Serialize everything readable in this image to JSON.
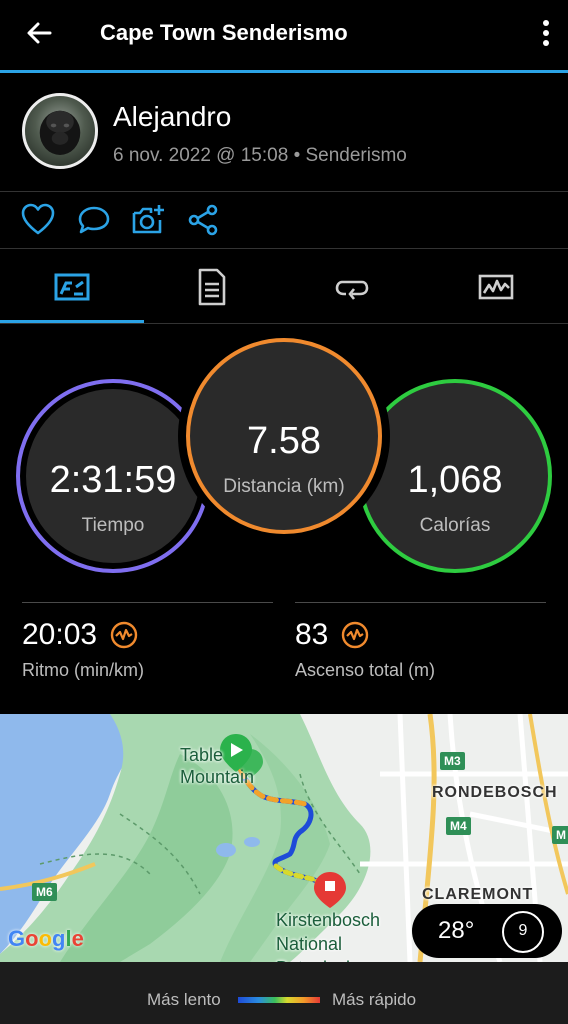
{
  "appbar": {
    "title": "Cape Town Senderismo"
  },
  "header": {
    "name": "Alejandro",
    "meta": "6 nov. 2022 @ 15:08 • Senderismo"
  },
  "actions": [
    "heart-icon",
    "comment-icon",
    "add-photo-icon",
    "share-icon"
  ],
  "tabs": [
    "stats-tab-icon",
    "details-tab-icon",
    "laps-tab-icon",
    "charts-tab-icon"
  ],
  "stats": {
    "time": {
      "value": "2:31:59",
      "label": "Tiempo",
      "color": "#7f6ef0"
    },
    "distance": {
      "value": "7.58",
      "label": "Distancia (km)",
      "color": "#f08a2e"
    },
    "calories": {
      "value": "1,068",
      "label": "Calorías",
      "color": "#2ecc40"
    }
  },
  "metrics": {
    "pace": {
      "value": "20:03",
      "label": "Ritmo (min/km)",
      "icon": "performance-icon"
    },
    "ascent": {
      "value": "83",
      "label": "Ascenso total (m)",
      "icon": "performance-icon"
    }
  },
  "map": {
    "labels": {
      "table_mountain": "Table\nMountain",
      "rondebosch": "RONDEBOSCH",
      "claremont": "CLAREMONT",
      "kirstenbosch": "Kirstenbosch\nNational\nBotanical"
    },
    "roads": {
      "m3": "M3",
      "m4": "M4",
      "m6": "M6",
      "m5": "M"
    },
    "google": "Google",
    "weather": {
      "temp": "28°",
      "wind": "9"
    }
  },
  "legend": {
    "slow": "Más lento",
    "fast": "Más rápido"
  },
  "colors": {
    "accent": "#2ba3e6"
  }
}
